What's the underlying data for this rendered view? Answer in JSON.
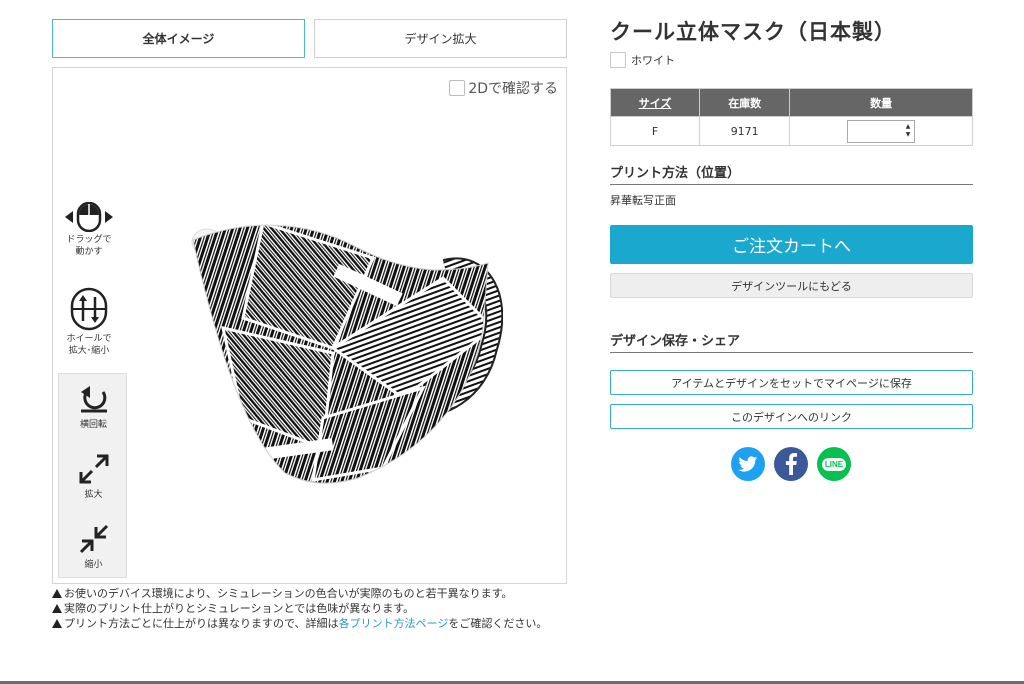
{
  "tabs": [
    {
      "label": "全体イメージ",
      "active": true
    },
    {
      "label": "デザイン拡大",
      "active": false
    }
  ],
  "viewer": {
    "toggle_2d_label": "2Dで確認する",
    "drag_label_1": "ドラッグで",
    "drag_label_2": "動かす",
    "wheel_label_1": "ホイールで",
    "wheel_label_2": "拡大･縮小",
    "rotate_label": "横回転",
    "zoom_in_label": "拡大",
    "zoom_out_label": "縮小"
  },
  "notes": {
    "note1": "お使いのデバイス環境により、シミュレーションの色合いが実際のものと若干異なります。",
    "note2": "実際のプリント仕上がりとシミュレーションとでは色味が異なります。",
    "note3_pre": "プリント方法ごとに仕上がりは異なりますので、詳細は",
    "note3_link": "各プリント方法ページ",
    "note3_post": "をご確認ください。"
  },
  "product": {
    "title": "クール立体マスク（日本製）",
    "color_option": "ホワイト"
  },
  "stock_table": {
    "headers": [
      "サイズ",
      "在庫数",
      "数量"
    ],
    "rows": [
      {
        "size": "F",
        "stock": "9171",
        "qty": ""
      }
    ]
  },
  "print_section": {
    "heading": "プリント方法（位置）",
    "value": "昇華転写正面"
  },
  "buttons": {
    "order": "ご注文カートへ",
    "back_to_tool": "デザインツールにもどる",
    "save_item": "アイテムとデザインをセットでマイページに保存",
    "design_link": "このデザインへのリンク"
  },
  "save_section": {
    "heading": "デザイン保存・シェア"
  },
  "social": {
    "line_text": "LINE",
    "colors": {
      "twitter": "#1da1f2",
      "facebook": "#3b5998",
      "line": "#06c152"
    }
  },
  "colors": {
    "accent": "#1aa8cf",
    "header_bg": "#666666"
  }
}
